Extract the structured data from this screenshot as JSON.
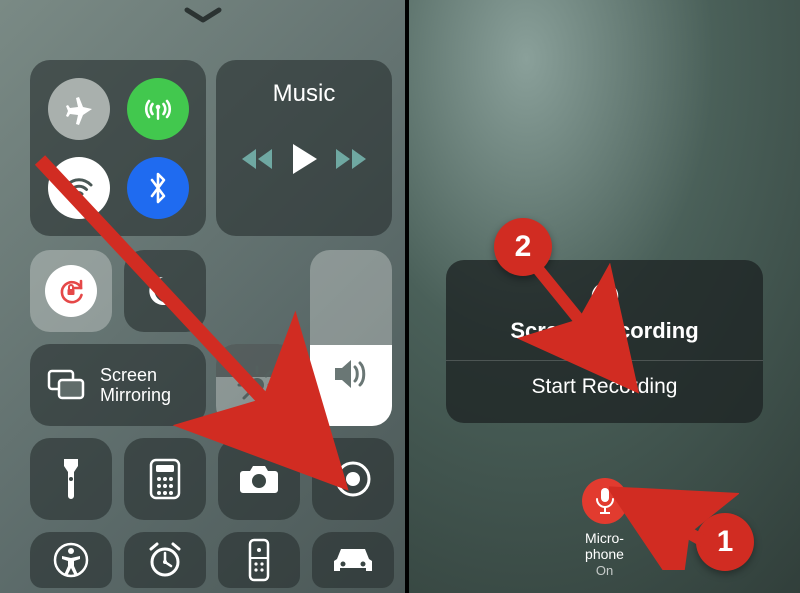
{
  "left": {
    "music_label": "Music",
    "screen_mirroring_line1": "Screen",
    "screen_mirroring_line2": "Mirroring",
    "connectivity": {
      "airplane": "airplane",
      "cellular": "cellular",
      "wifi": "wifi",
      "bluetooth": "bluetooth"
    },
    "toggles": {
      "orientation_lock": "orientation-lock",
      "dnd": "do-not-disturb",
      "brightness": "brightness",
      "volume": "volume"
    },
    "shortcuts": [
      "flashlight",
      "calculator",
      "camera",
      "screen-record",
      "accessibility",
      "clock",
      "apple-tv-remote",
      "carplay"
    ]
  },
  "right": {
    "sheet_title": "Screen Recording",
    "start_label": "Start Recording",
    "mic_label_line1": "Micro-",
    "mic_label_line2": "phone",
    "mic_status": "On"
  },
  "callouts": {
    "one": "1",
    "two": "2"
  },
  "colors": {
    "accent_green": "#42c84e",
    "accent_blue": "#1f6bf0",
    "accent_red": "#d12c22",
    "toggle_white": "#ffffff",
    "lock_red": "#e54848"
  }
}
